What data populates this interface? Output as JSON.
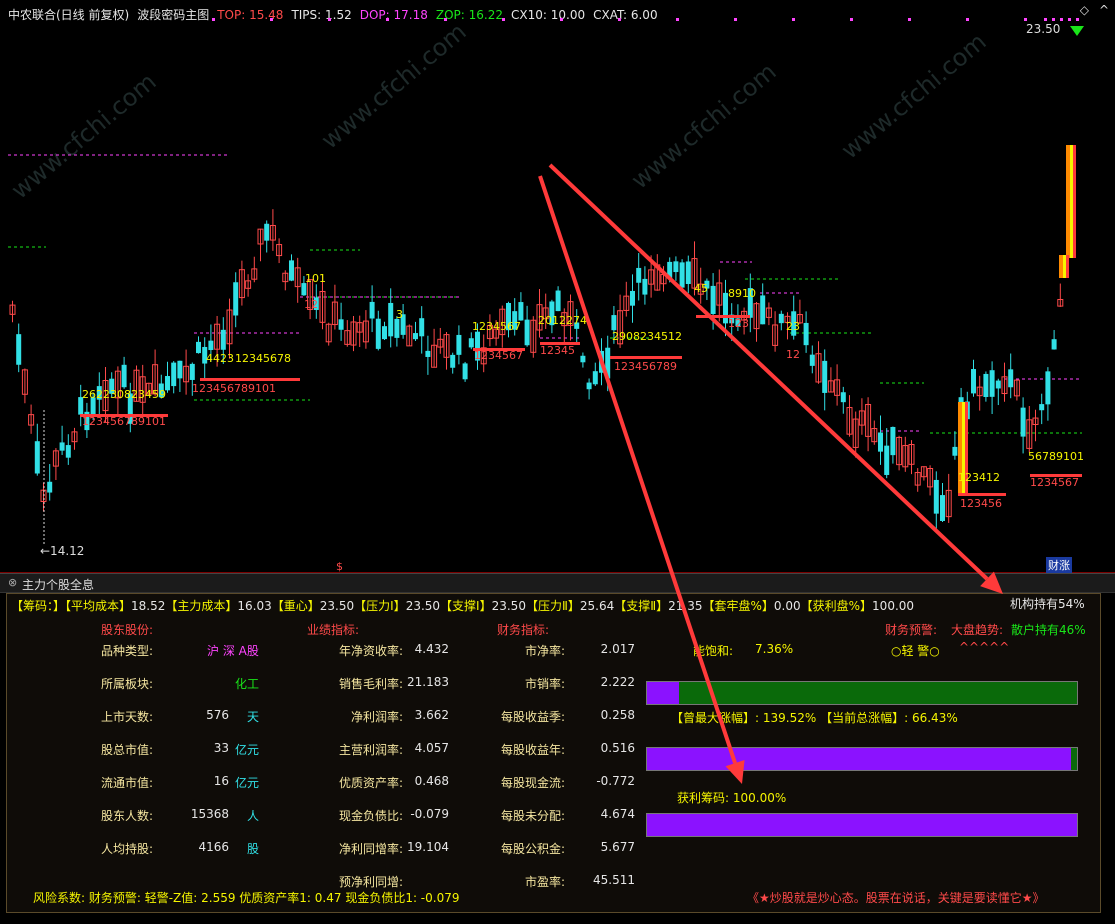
{
  "header": {
    "stock": "中农联合(日线 前复权)",
    "indicator": "波段密码主图",
    "top": "TOP: 15.48",
    "tips": "TIPS: 1.52",
    "dop": "DOP: 17.18",
    "zop": "ZOP: 16.22",
    "cx10": "CX10: 10.00",
    "cxat": "CXAT: 6.00"
  },
  "chart": {
    "price_high_label": "23.50",
    "price_low_label": "←14.12",
    "corner_tag": "财涨",
    "s_marker": "$",
    "watermark": "www.cfchi.com",
    "labels": [
      {
        "text": "101",
        "c": "#f5f500"
      },
      {
        "text": "12345678",
        "c": "#f5f500"
      },
      {
        "text": "4423",
        "c": "#f5f500"
      },
      {
        "text": "123456789101",
        "c": "#ff4a4a"
      },
      {
        "text": "262230823459",
        "c": "#f5f500"
      },
      {
        "text": "123456789101",
        "c": "#ff4a4a"
      },
      {
        "text": "1234567",
        "c": "#f5f500"
      },
      {
        "text": "1234567",
        "c": "#ff4a4a"
      },
      {
        "text": "2012274",
        "c": "#f5f500"
      },
      {
        "text": "12345",
        "c": "#ff4a4a"
      },
      {
        "text": "2908234512",
        "c": "#f5f500"
      },
      {
        "text": "123456789",
        "c": "#ff4a4a"
      },
      {
        "text": "45",
        "c": "#f5f500"
      },
      {
        "text": "8910",
        "c": "#f5f500"
      },
      {
        "text": "123",
        "c": "#ff4a4a"
      },
      {
        "text": "23",
        "c": "#f5f500"
      },
      {
        "text": "12",
        "c": "#ff4a4a"
      },
      {
        "text": "123412",
        "c": "#f5f500"
      },
      {
        "text": "123456",
        "c": "#ff4a4a"
      },
      {
        "text": "56789101",
        "c": "#f5f500"
      },
      {
        "text": "1234567",
        "c": "#ff4a4a"
      },
      {
        "text": "3",
        "c": "#f5f500"
      },
      {
        "text": "12",
        "c": "#ff4a4a"
      }
    ]
  },
  "panel": {
    "title": "主力个股全息",
    "cost_line": {
      "chips_label": "【筹码：】",
      "avg_cost_label": "【平均成本】",
      "avg_cost": "18.52",
      "main_cost_label": "【主力成本】",
      "main_cost": "16.03",
      "center_label": "【重心】",
      "center": "23.50",
      "p1_label": "【压力Ⅰ】",
      "p1": "23.50",
      "s1_label": "【支撑Ⅰ】",
      "s1": "23.50",
      "p2_label": "【压力Ⅱ】",
      "p2": "25.64",
      "s2_label": "【支撑Ⅱ】",
      "s2": "21.35",
      "trap_label": "【套牢盘%】",
      "trap": "0.00",
      "profit_label": "【获利盘%】",
      "profit": "100.00"
    },
    "institution": "机构持有54%",
    "retail": "散户持有46%",
    "sec_holder": "股东股份:",
    "sec_perf": "业绩指标:",
    "sec_fin": "财务指标:",
    "fin_warning_label": "财务预警:",
    "market_trend_label": "大盘趋势:",
    "warning_level": "○轻 警○",
    "trend_value": "^^^^^",
    "holder_rows": [
      {
        "label": "品种类型:",
        "value": "沪 深 A股",
        "unit": ""
      },
      {
        "label": "所属板块:",
        "value": "化工",
        "unit": ""
      },
      {
        "label": "上市天数:",
        "value": "576",
        "unit": "天"
      },
      {
        "label": "股总市值:",
        "value": "33",
        "unit": "亿元"
      },
      {
        "label": "流通市值:",
        "value": "16",
        "unit": "亿元"
      },
      {
        "label": "股东人数:",
        "value": "15368",
        "unit": "人"
      },
      {
        "label": "人均持股:",
        "value": "4166",
        "unit": "股"
      }
    ],
    "perf_rows": [
      {
        "label": "年净资收率:",
        "value": "4.432"
      },
      {
        "label": "销售毛利率:",
        "value": "21.183"
      },
      {
        "label": "净利润率:",
        "value": "3.662"
      },
      {
        "label": "主营利润率:",
        "value": "4.057"
      },
      {
        "label": "优质资产率:",
        "value": "0.468"
      },
      {
        "label": "现金负债比:",
        "value": "-0.079"
      },
      {
        "label": "净利同增率:",
        "value": "19.104"
      },
      {
        "label": "预净利同增:",
        "value": ""
      }
    ],
    "fin_rows": [
      {
        "label": "市净率:",
        "value": "2.017"
      },
      {
        "label": "市销率:",
        "value": "2.222"
      },
      {
        "label": "每股收益季:",
        "value": "0.258"
      },
      {
        "label": "每股收益年:",
        "value": "0.516"
      },
      {
        "label": "每股现金流:",
        "value": "-0.772"
      },
      {
        "label": "每股未分配:",
        "value": "4.674"
      },
      {
        "label": "每股公积金:",
        "value": "5.677"
      },
      {
        "label": "市盈率:",
        "value": "45.511"
      }
    ],
    "saturation_label": "能饱和:",
    "saturation_value": "7.36%",
    "saturation_fraction": 0.0736,
    "max_gain_label": "【曾最大涨幅】:",
    "max_gain_value": "139.52%",
    "cur_gain_label": "【当前总涨幅】:",
    "cur_gain_value": "66.43%",
    "gain_fraction": 0.9857,
    "profit_chip_label": "获利筹码:",
    "profit_chip_value": "100.00%",
    "profit_chip_fraction": 1.0,
    "risk_line": "风险系数: 财务预警: 轻警-Z值: 2.559 优质资产率1: 0.47 现金负债比1: -0.079",
    "motto": "《★炒股就是炒心态。股票在说话，关键是要读懂它★》"
  },
  "colors": {
    "up": "#ff4a4a",
    "down": "#31e0e6",
    "bar_purple": "#8b12ff",
    "bar_green": "#0a6a0a",
    "arrow": "#ff3a3a"
  }
}
